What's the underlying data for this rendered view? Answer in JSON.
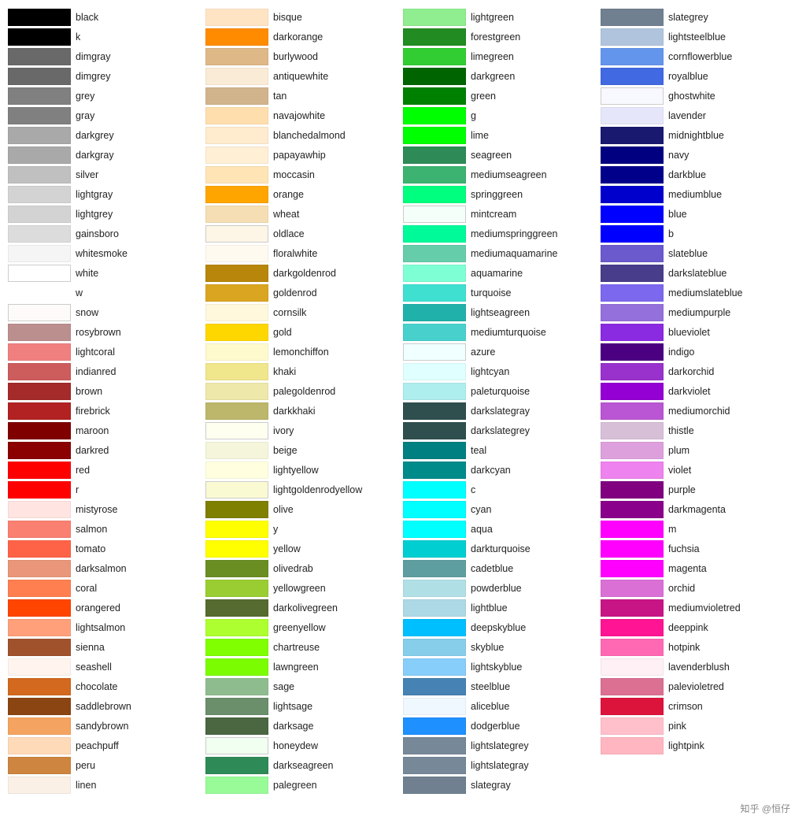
{
  "columns": [
    {
      "items": [
        {
          "color": "#000000",
          "name": "black"
        },
        {
          "color": "#000000",
          "name": "k"
        },
        {
          "color": "#696969",
          "name": "dimgray"
        },
        {
          "color": "#696969",
          "name": "dimgrey"
        },
        {
          "color": "#808080",
          "name": "grey"
        },
        {
          "color": "#808080",
          "name": "gray"
        },
        {
          "color": "#a9a9a9",
          "name": "darkgrey"
        },
        {
          "color": "#a9a9a9",
          "name": "darkgray"
        },
        {
          "color": "#c0c0c0",
          "name": "silver"
        },
        {
          "color": "#d3d3d3",
          "name": "lightgray"
        },
        {
          "color": "#d3d3d3",
          "name": "lightgrey"
        },
        {
          "color": "#dcdcdc",
          "name": "gainsboro"
        },
        {
          "color": "#f5f5f5",
          "name": "whitesmoke"
        },
        {
          "color": "#ffffff",
          "name": "white",
          "border": true
        },
        {
          "color": "#ffffff",
          "name": "w",
          "noSwatch": true
        },
        {
          "color": "#fffafa",
          "name": "snow"
        },
        {
          "color": "#bc8f8f",
          "name": "rosybrown"
        },
        {
          "color": "#f08080",
          "name": "lightcoral"
        },
        {
          "color": "#cd5c5c",
          "name": "indianred"
        },
        {
          "color": "#a52a2a",
          "name": "brown"
        },
        {
          "color": "#b22222",
          "name": "firebrick"
        },
        {
          "color": "#800000",
          "name": "maroon"
        },
        {
          "color": "#8b0000",
          "name": "darkred"
        },
        {
          "color": "#ff0000",
          "name": "red"
        },
        {
          "color": "#ff0000",
          "name": "r"
        },
        {
          "color": "#ffe4e1",
          "name": "mistyrose"
        },
        {
          "color": "#fa8072",
          "name": "salmon"
        },
        {
          "color": "#ff6347",
          "name": "tomato"
        },
        {
          "color": "#e9967a",
          "name": "darksalmon"
        },
        {
          "color": "#ff7f50",
          "name": "coral"
        },
        {
          "color": "#ff4500",
          "name": "orangered"
        },
        {
          "color": "#ffa07a",
          "name": "lightsalmon"
        },
        {
          "color": "#a0522d",
          "name": "sienna"
        },
        {
          "color": "#fff5ee",
          "name": "seashell"
        },
        {
          "color": "#d2691e",
          "name": "chocolate"
        },
        {
          "color": "#8b4513",
          "name": "saddlebrown"
        },
        {
          "color": "#f4a460",
          "name": "sandybrown"
        },
        {
          "color": "#ffdab9",
          "name": "peachpuff"
        },
        {
          "color": "#cd853f",
          "name": "peru"
        },
        {
          "color": "#faf0e6",
          "name": "linen"
        }
      ]
    },
    {
      "items": [
        {
          "color": "#ffe4c4",
          "name": "bisque"
        },
        {
          "color": "#ff8c00",
          "name": "darkorange"
        },
        {
          "color": "#deb887",
          "name": "burlywood"
        },
        {
          "color": "#faebd7",
          "name": "antiquewhite"
        },
        {
          "color": "#d2b48c",
          "name": "tan"
        },
        {
          "color": "#ffdead",
          "name": "navajowhite"
        },
        {
          "color": "#ffebcd",
          "name": "blanchedalmond"
        },
        {
          "color": "#ffefd5",
          "name": "papayawhip"
        },
        {
          "color": "#ffe4b5",
          "name": "moccasin"
        },
        {
          "color": "#ffa500",
          "name": "orange"
        },
        {
          "color": "#f5deb3",
          "name": "wheat"
        },
        {
          "color": "#fdf5e6",
          "name": "oldlace"
        },
        {
          "color": "#fffaf0",
          "name": "floralwhite"
        },
        {
          "color": "#b8860b",
          "name": "darkgoldenrod"
        },
        {
          "color": "#daa520",
          "name": "goldenrod"
        },
        {
          "color": "#fff8dc",
          "name": "cornsilk"
        },
        {
          "color": "#ffd700",
          "name": "gold"
        },
        {
          "color": "#fffacd",
          "name": "lemonchiffon"
        },
        {
          "color": "#f0e68c",
          "name": "khaki"
        },
        {
          "color": "#eee8aa",
          "name": "palegoldenrod"
        },
        {
          "color": "#bdb76b",
          "name": "darkkhaki"
        },
        {
          "color": "#fffff0",
          "name": "ivory"
        },
        {
          "color": "#f5f5dc",
          "name": "beige"
        },
        {
          "color": "#ffffe0",
          "name": "lightyellow"
        },
        {
          "color": "#fafad2",
          "name": "lightgoldenrodyellow"
        },
        {
          "color": "#808000",
          "name": "olive"
        },
        {
          "color": "#ffff00",
          "name": "y"
        },
        {
          "color": "#ffff00",
          "name": "yellow"
        },
        {
          "color": "#6b8e23",
          "name": "olivedrab"
        },
        {
          "color": "#9acd32",
          "name": "yellowgreen"
        },
        {
          "color": "#556b2f",
          "name": "darkolivegreen"
        },
        {
          "color": "#adff2f",
          "name": "greenyellow"
        },
        {
          "color": "#7fff00",
          "name": "chartreuse"
        },
        {
          "color": "#7cfc00",
          "name": "lawngreen"
        },
        {
          "color": "#8fbc8f",
          "name": "sage"
        },
        {
          "color": "#6b8e6b",
          "name": "lightsage"
        },
        {
          "color": "#4a6741",
          "name": "darksage"
        },
        {
          "color": "#f0fff0",
          "name": "honeydew"
        },
        {
          "color": "#2e8b57",
          "name": "darkseagreen"
        },
        {
          "color": "#98fb98",
          "name": "palegreen"
        }
      ]
    },
    {
      "items": [
        {
          "color": "#90ee90",
          "name": "lightgreen"
        },
        {
          "color": "#228b22",
          "name": "forestgreen"
        },
        {
          "color": "#32cd32",
          "name": "limegreen"
        },
        {
          "color": "#006400",
          "name": "darkgreen"
        },
        {
          "color": "#008000",
          "name": "green"
        },
        {
          "color": "#00ff00",
          "name": "g"
        },
        {
          "color": "#00ff00",
          "name": "lime"
        },
        {
          "color": "#2e8b57",
          "name": "seagreen"
        },
        {
          "color": "#3cb371",
          "name": "mediumseagreen"
        },
        {
          "color": "#00ff7f",
          "name": "springgreen"
        },
        {
          "color": "#f5fffa",
          "name": "mintcream"
        },
        {
          "color": "#00fa9a",
          "name": "mediumspringgreen"
        },
        {
          "color": "#66cdaa",
          "name": "mediumaquamarine"
        },
        {
          "color": "#7fffd4",
          "name": "aquamarine"
        },
        {
          "color": "#40e0d0",
          "name": "turquoise"
        },
        {
          "color": "#20b2aa",
          "name": "lightseagreen"
        },
        {
          "color": "#48d1cc",
          "name": "mediumturquoise"
        },
        {
          "color": "#f0ffff",
          "name": "azure"
        },
        {
          "color": "#e0ffff",
          "name": "lightcyan"
        },
        {
          "color": "#afeeee",
          "name": "paleturquoise"
        },
        {
          "color": "#2f4f4f",
          "name": "darkslategray"
        },
        {
          "color": "#2f4f4f",
          "name": "darkslategrey"
        },
        {
          "color": "#008080",
          "name": "teal"
        },
        {
          "color": "#008b8b",
          "name": "darkcyan"
        },
        {
          "color": "#00ffff",
          "name": "c"
        },
        {
          "color": "#00ffff",
          "name": "cyan"
        },
        {
          "color": "#00ffff",
          "name": "aqua"
        },
        {
          "color": "#00ced1",
          "name": "darkturquoise"
        },
        {
          "color": "#5f9ea0",
          "name": "cadetblue"
        },
        {
          "color": "#b0e0e6",
          "name": "powderblue"
        },
        {
          "color": "#add8e6",
          "name": "lightblue"
        },
        {
          "color": "#00bfff",
          "name": "deepskyblue"
        },
        {
          "color": "#87ceeb",
          "name": "skyblue"
        },
        {
          "color": "#87cefa",
          "name": "lightskyblue"
        },
        {
          "color": "#4682b4",
          "name": "steelblue"
        },
        {
          "color": "#f0f8ff",
          "name": "aliceblue"
        },
        {
          "color": "#1e90ff",
          "name": "dodgerblue"
        },
        {
          "color": "#778899",
          "name": "lightslategrey"
        },
        {
          "color": "#778899",
          "name": "lightslategray"
        },
        {
          "color": "#708090",
          "name": "slategray"
        }
      ]
    },
    {
      "items": [
        {
          "color": "#708090",
          "name": "slategrey"
        },
        {
          "color": "#b0c4de",
          "name": "lightsteelblue"
        },
        {
          "color": "#6495ed",
          "name": "cornflowerblue"
        },
        {
          "color": "#4169e1",
          "name": "royalblue"
        },
        {
          "color": "#f8f8ff",
          "name": "ghostwhite"
        },
        {
          "color": "#e6e6fa",
          "name": "lavender"
        },
        {
          "color": "#191970",
          "name": "midnightblue"
        },
        {
          "color": "#000080",
          "name": "navy"
        },
        {
          "color": "#00008b",
          "name": "darkblue"
        },
        {
          "color": "#0000cd",
          "name": "mediumblue"
        },
        {
          "color": "#0000ff",
          "name": "blue"
        },
        {
          "color": "#0000ff",
          "name": "b"
        },
        {
          "color": "#6a5acd",
          "name": "slateblue"
        },
        {
          "color": "#483d8b",
          "name": "darkslateblue"
        },
        {
          "color": "#7b68ee",
          "name": "mediumslateblue"
        },
        {
          "color": "#9370db",
          "name": "mediumpurple"
        },
        {
          "color": "#8a2be2",
          "name": "blueviolet"
        },
        {
          "color": "#4b0082",
          "name": "indigo"
        },
        {
          "color": "#9932cc",
          "name": "darkorchid"
        },
        {
          "color": "#9400d3",
          "name": "darkviolet"
        },
        {
          "color": "#ba55d3",
          "name": "mediumorchid"
        },
        {
          "color": "#d8bfd8",
          "name": "thistle"
        },
        {
          "color": "#dda0dd",
          "name": "plum"
        },
        {
          "color": "#ee82ee",
          "name": "violet"
        },
        {
          "color": "#800080",
          "name": "purple"
        },
        {
          "color": "#8b008b",
          "name": "darkmagenta"
        },
        {
          "color": "#ff00ff",
          "name": "m"
        },
        {
          "color": "#ff00ff",
          "name": "fuchsia"
        },
        {
          "color": "#ff00ff",
          "name": "magenta"
        },
        {
          "color": "#da70d6",
          "name": "orchid"
        },
        {
          "color": "#c71585",
          "name": "mediumvioletred"
        },
        {
          "color": "#ff1493",
          "name": "deeppink"
        },
        {
          "color": "#ff69b4",
          "name": "hotpink"
        },
        {
          "color": "#fff0f5",
          "name": "lavenderblush"
        },
        {
          "color": "#db7093",
          "name": "palevioletred"
        },
        {
          "color": "#dc143c",
          "name": "crimson"
        },
        {
          "color": "#ffc0cb",
          "name": "pink"
        },
        {
          "color": "#ffb6c1",
          "name": "lightpink"
        }
      ]
    }
  ],
  "watermark": "知乎 @恒仔"
}
